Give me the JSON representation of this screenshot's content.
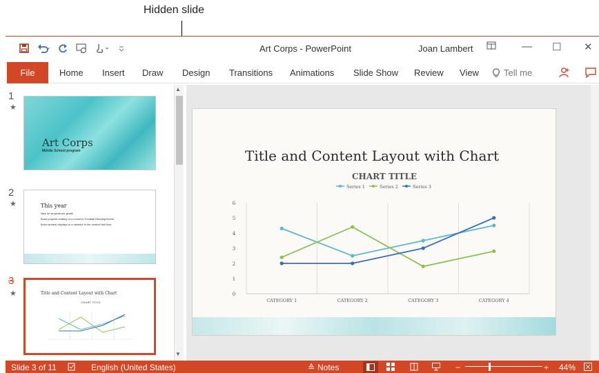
{
  "callout": {
    "label": "Hidden slide"
  },
  "window": {
    "title": "Art Corps - PowerPoint",
    "user": "Joan Lambert",
    "minimize": "—",
    "maximize": "☐",
    "close": "✕"
  },
  "ribbon": {
    "file": "File",
    "tabs": [
      "Home",
      "Insert",
      "Draw",
      "Design",
      "Transitions",
      "Animations",
      "Slide Show",
      "Review",
      "View"
    ],
    "tellme": "Tell me"
  },
  "thumbnails": [
    {
      "number": "1",
      "title": "Art Corps",
      "subtitle": "Middle School program"
    },
    {
      "number": "2",
      "title": "This year",
      "bullets": [
        "New art projects per grade",
        "Book projects relating to a common Football Reading theme",
        "Book student displays in a network in the central Hall floor"
      ]
    },
    {
      "number": "3",
      "title": "Title and Content Layout with Chart",
      "chart_title": "CHART TITLE"
    }
  ],
  "slide": {
    "title": "Title and Content Layout with Chart"
  },
  "chart_data": {
    "type": "line",
    "title": "CHART TITLE",
    "categories": [
      "CATEGORY 1",
      "CATEGORY 2",
      "CATEGORY 3",
      "CATEGORY 4"
    ],
    "series": [
      {
        "name": "Series 1",
        "values": [
          4.3,
          2.5,
          3.5,
          4.5
        ],
        "color": "#5bb8c9"
      },
      {
        "name": "Series 2",
        "values": [
          2.4,
          4.4,
          1.8,
          2.8
        ],
        "color": "#8cc152"
      },
      {
        "name": "Series 3",
        "values": [
          2,
          2,
          3,
          5
        ],
        "color": "#3a6fb5"
      }
    ],
    "y_ticks": [
      "0",
      "1",
      "2",
      "3",
      "4",
      "5",
      "6"
    ],
    "ylim": [
      0,
      6
    ],
    "legend": "top"
  },
  "status": {
    "slide_of": "Slide 3 of 11",
    "language": "English (United States)",
    "notes": "Notes",
    "zoom": "44%"
  },
  "colors": {
    "accent": "#d24726"
  }
}
